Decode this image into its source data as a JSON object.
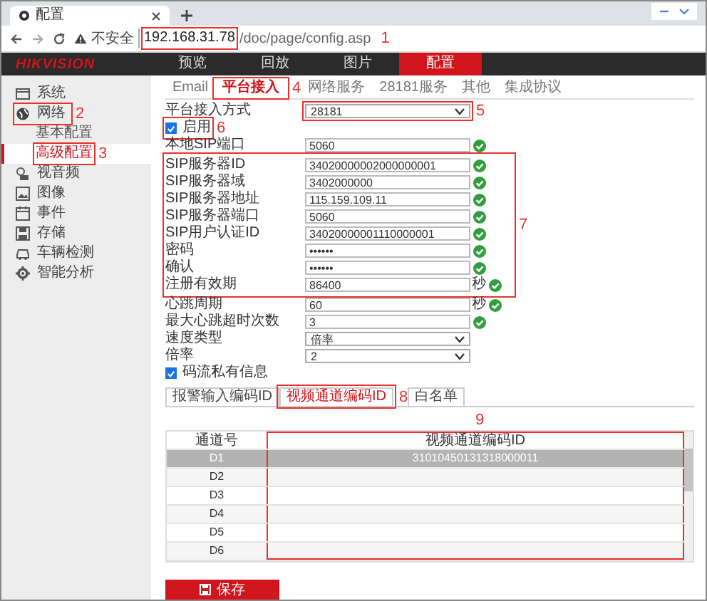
{
  "browser": {
    "tab_title": "配置",
    "address": {
      "warning": "不安全",
      "host": "192.168.31.78",
      "path": "/doc/page/config.asp",
      "callout": "1"
    }
  },
  "header": {
    "logo": "HIKVISION",
    "nav": [
      {
        "label": "预览",
        "selected": false
      },
      {
        "label": "回放",
        "selected": false
      },
      {
        "label": "图片",
        "selected": false
      },
      {
        "label": "配置",
        "selected": true
      }
    ]
  },
  "sidebar": {
    "items": [
      {
        "label": "系统",
        "selected": false
      },
      {
        "label": "网络",
        "selected": false,
        "expanded": true,
        "callout": "2",
        "children": [
          {
            "label": "基本配置",
            "selected": false
          },
          {
            "label": "高级配置",
            "selected": true,
            "callout": "3"
          }
        ]
      },
      {
        "label": "视音频",
        "selected": false
      },
      {
        "label": "图像",
        "selected": false
      },
      {
        "label": "事件",
        "selected": false
      },
      {
        "label": "存储",
        "selected": false
      },
      {
        "label": "车辆检测",
        "selected": false
      },
      {
        "label": "智能分析",
        "selected": false
      }
    ]
  },
  "tabs": [
    {
      "label": "Email",
      "selected": false
    },
    {
      "label": "平台接入",
      "selected": true,
      "callout": "4"
    },
    {
      "label": "网络服务",
      "selected": false
    },
    {
      "label": "28181服务",
      "selected": false
    },
    {
      "label": "其他",
      "selected": false
    },
    {
      "label": "集成协议",
      "selected": false
    }
  ],
  "form": [
    {
      "kind": "select",
      "label": "平台接入方式",
      "value": "28181",
      "callout": "5"
    },
    {
      "kind": "checkbox",
      "label": "启用",
      "checked": true,
      "callout": "6"
    },
    {
      "kind": "text",
      "label": "本地SIP端口",
      "value": "5060",
      "valid": true
    },
    {
      "kind": "group",
      "callout": "7",
      "rows": [
        {
          "kind": "text",
          "label": "SIP服务器ID",
          "value": "34020000002000000001",
          "valid": true
        },
        {
          "kind": "text",
          "label": "SIP服务器域",
          "value": "3402000000",
          "valid": true
        },
        {
          "kind": "text",
          "label": "SIP服务器地址",
          "value": "115.159.109.11",
          "valid": true
        },
        {
          "kind": "text",
          "label": "SIP服务器端口",
          "value": "5060",
          "valid": true
        },
        {
          "kind": "text",
          "label": "SIP用户认证ID",
          "value": "34020000001110000001",
          "valid": true
        },
        {
          "kind": "text",
          "label": "密码",
          "value": "••••••",
          "valid": true
        },
        {
          "kind": "text",
          "label": "确认",
          "value": "••••••",
          "valid": true
        },
        {
          "kind": "text",
          "label": "注册有效期",
          "value": "86400",
          "unit": "秒",
          "valid": true
        }
      ]
    },
    {
      "kind": "text",
      "label": "心跳周期",
      "value": "60",
      "unit": "秒",
      "valid": true
    },
    {
      "kind": "text",
      "label": "最大心跳超时次数",
      "value": "3",
      "valid": true
    },
    {
      "kind": "select",
      "label": "速度类型",
      "value": "倍率"
    },
    {
      "kind": "select",
      "label": "倍率",
      "value": "2"
    },
    {
      "kind": "checkbox",
      "label": "码流私有信息",
      "checked": true
    }
  ],
  "subtabs": [
    {
      "label": "报警输入编码ID",
      "selected": false
    },
    {
      "label": "视频通道编码ID",
      "selected": true,
      "callout": "8"
    },
    {
      "label": "白名单",
      "selected": false
    }
  ],
  "table": {
    "columns": [
      {
        "label": "通道号"
      },
      {
        "label": "视频通道编码ID",
        "callout": "9"
      }
    ],
    "rows": [
      {
        "cells": [
          "D1",
          "31010450131318000011"
        ],
        "selected": true
      },
      {
        "cells": [
          "D2"
        ],
        "selected": false
      },
      {
        "cells": [
          "D3"
        ],
        "selected": false
      },
      {
        "cells": [
          "D4"
        ],
        "selected": false
      },
      {
        "cells": [
          "D5"
        ],
        "selected": false
      },
      {
        "cells": [
          "D6"
        ],
        "selected": false
      }
    ]
  },
  "save_button": "保存"
}
